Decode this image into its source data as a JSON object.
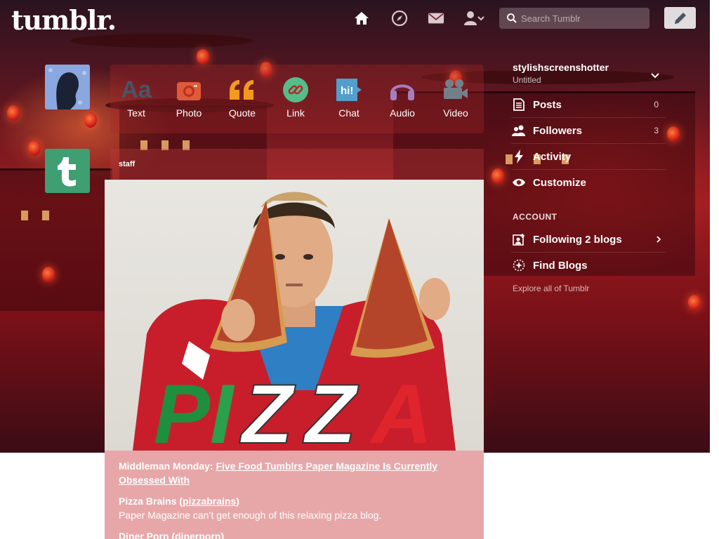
{
  "header": {
    "logo": "tumblr.",
    "search_placeholder": "Search Tumblr",
    "nav_icons": [
      "home-icon",
      "explore-compass-icon",
      "inbox-envelope-icon",
      "account-person-icon"
    ]
  },
  "post_types": [
    {
      "label": "Text",
      "icon": "text-aa-icon",
      "color": "#4a5468"
    },
    {
      "label": "Photo",
      "icon": "camera-icon",
      "color": "#e05a3a"
    },
    {
      "label": "Quote",
      "icon": "quote-icon",
      "color": "#f29a1f"
    },
    {
      "label": "Link",
      "icon": "link-icon",
      "color": "#56bc8a"
    },
    {
      "label": "Chat",
      "icon": "chat-icon",
      "color": "#529ecc"
    },
    {
      "label": "Audio",
      "icon": "headphones-icon",
      "color": "#a77dc2"
    },
    {
      "label": "Video",
      "icon": "video-camera-icon",
      "color": "#748089"
    }
  ],
  "post": {
    "author": "staff",
    "image_word": "PIZZA",
    "body": {
      "p1_prefix": "Middleman Monday: ",
      "p1_link": "Five Food Tumblrs Paper Magazine Is Currently Obsessed With",
      "p2_prefix": "Pizza Brains (",
      "p2_link": "pizzabrains",
      "p2_suffix": ")",
      "p2_desc": "Paper Magazine can’t get enough of this relaxing pizza blog.",
      "p3_prefix": "Diner Porn (",
      "p3_link": "dinerporn",
      "p3_suffix": ")"
    }
  },
  "sidebar": {
    "blog_name": "stylishscreenshotter",
    "blog_subtitle": "Untitled",
    "items": [
      {
        "label": "Posts",
        "count": "0",
        "icon": "posts-document-icon"
      },
      {
        "label": "Followers",
        "count": "3",
        "icon": "followers-people-icon"
      },
      {
        "label": "Activity",
        "count": "",
        "icon": "activity-bolt-icon"
      },
      {
        "label": "Customize",
        "count": "",
        "icon": "customize-eye-icon"
      }
    ],
    "account_heading": "ACCOUNT",
    "account_items": [
      {
        "label": "Following 2 blogs",
        "icon": "following-person-plus-icon"
      },
      {
        "label": "Find Blogs",
        "icon": "find-blogs-sparkle-icon"
      }
    ],
    "explore_text": "Explore all of Tumblr"
  },
  "colors": {
    "staff_avatar": "#3f9e72",
    "post_body_bg": "#e7a7a9",
    "theme_red": "#9c1d1f"
  }
}
